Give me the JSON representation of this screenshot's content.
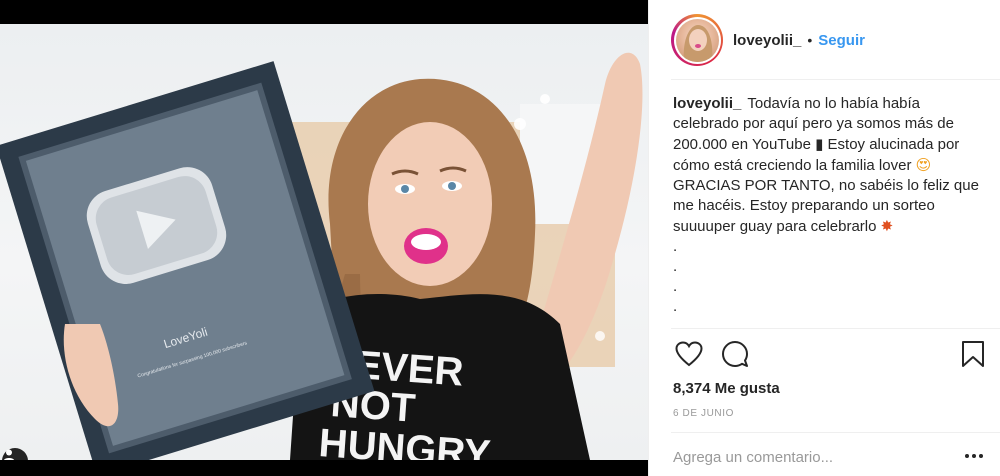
{
  "post": {
    "photo_alt": "",
    "plaque_name": "LoveYoli",
    "plaque_subtext": "Congratulations for surpassing 100,000 subscribers",
    "shirt_text_1": "NEVER",
    "shirt_text_2": "NOT",
    "shirt_text_3": "HUNGRY"
  },
  "header": {
    "username": "loveyolii_",
    "separator": "•",
    "follow_label": "Seguir"
  },
  "caption": {
    "username": "loveyolii_",
    "text_1": "Todavía no lo había había celebrado por aquí pero ya somos más de 200.000 en YouTube",
    "emoji_1": "▮",
    "text_2": "Estoy alucinada por cómo está creciendo la familia lover",
    "emoji_2": "😍",
    "text_3": "GRACIAS POR TANTO, no sabéis lo feliz que me hacéis. Estoy preparando un sorteo suuuuper guay para celebrarlo",
    "emoji_3": "✸",
    "dots": [
      ".",
      ".",
      ".",
      ".",
      "."
    ]
  },
  "engagement": {
    "likes_text": "8,374 Me gusta",
    "date_text": "6 DE JUNIO"
  },
  "comment": {
    "placeholder": "Agrega un comentario..."
  }
}
